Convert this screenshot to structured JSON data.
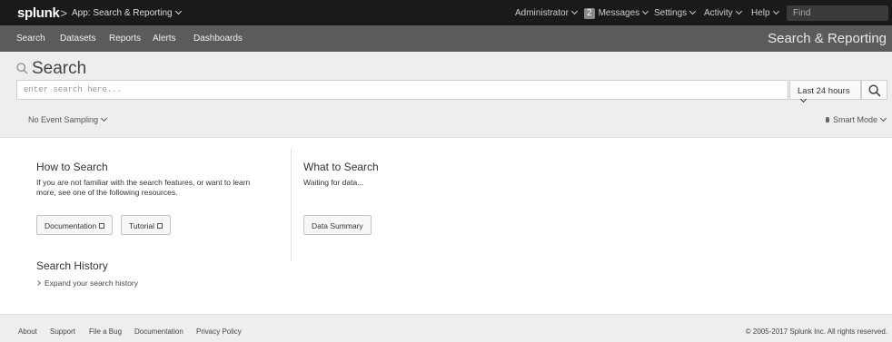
{
  "topbar": {
    "logo": "splunk",
    "logo_suffix": ">",
    "app_menu": "App: Search & Reporting",
    "user_menu": "Administrator",
    "messages_count": "2",
    "messages_menu": "Messages",
    "settings_menu": "Settings",
    "activity_menu": "Activity",
    "help_menu": "Help",
    "find_placeholder": "Find"
  },
  "appbar": {
    "items": [
      "Search",
      "Datasets",
      "Reports",
      "Alerts",
      "Dashboards"
    ],
    "app_title": "Search & Reporting"
  },
  "search": {
    "heading": "Search",
    "placeholder": "enter search here...",
    "time_range": "Last 24 hours",
    "sampling": "No Event Sampling",
    "mode": "Smart Mode"
  },
  "how_to_search": {
    "heading": "How to Search",
    "text_line1": "If you are not familiar with the search features, or want to learn",
    "text_line2": "more, see one of the following resources.",
    "doc_button": "Documentation",
    "tutorial_button": "Tutorial"
  },
  "what_to_search": {
    "heading": "What to Search",
    "text": "Waiting for data...",
    "summary_button": "Data Summary"
  },
  "history": {
    "heading": "Search History",
    "expand": "Expand your search history"
  },
  "footer": {
    "links": [
      "About",
      "Support",
      "File a Bug",
      "Documentation",
      "Privacy Policy"
    ],
    "copyright": "© 2005-2017 Splunk Inc. All rights reserved."
  }
}
